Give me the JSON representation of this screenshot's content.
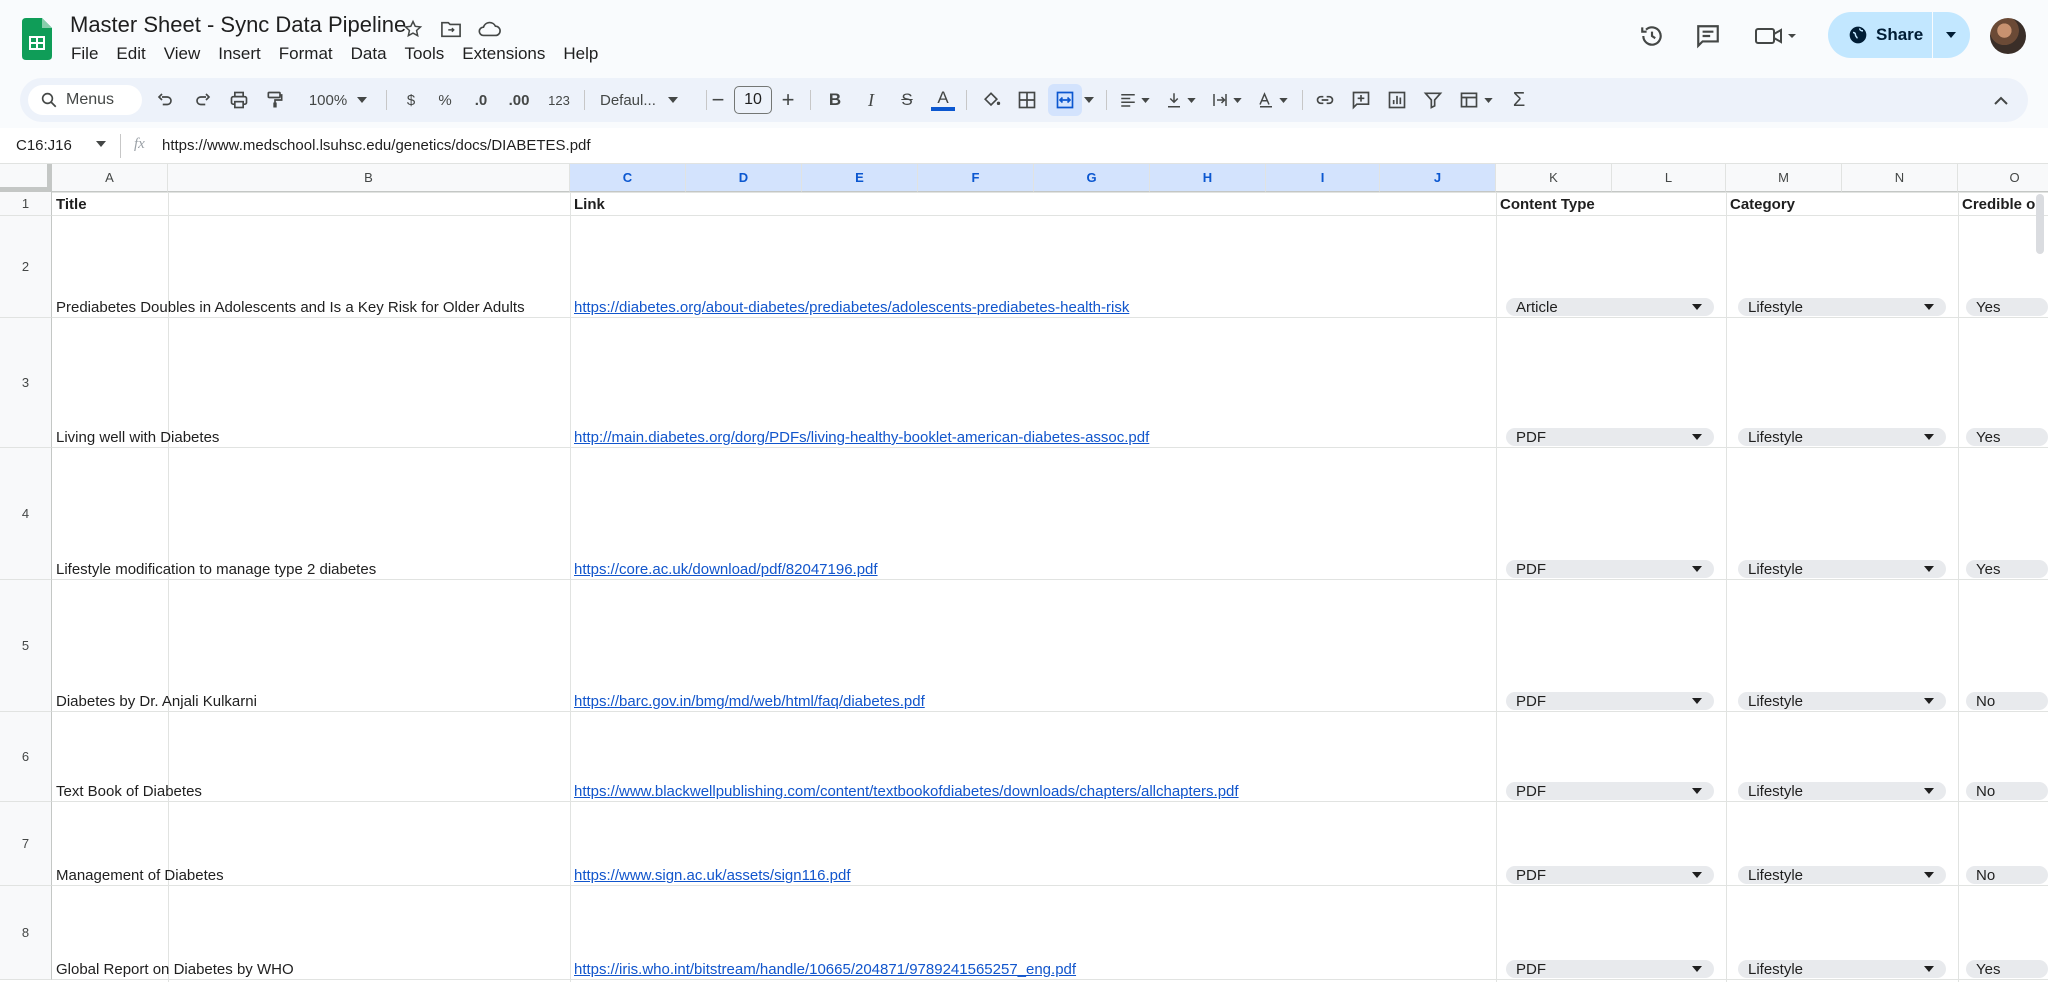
{
  "header": {
    "doc_title": "Master Sheet - Sync Data Pipeline",
    "menus": [
      "File",
      "Edit",
      "View",
      "Insert",
      "Format",
      "Data",
      "Tools",
      "Extensions",
      "Help"
    ],
    "share_label": "Share"
  },
  "toolbar": {
    "search_placeholder": "Menus",
    "zoom": "100%",
    "currency": "$",
    "percent": "%",
    "dec_decrease": ".0",
    "dec_increase": ".00",
    "number_format": "123",
    "font": "Defaul...",
    "font_size": "10"
  },
  "formula_bar": {
    "name_box": "C16:J16",
    "fx": "fx",
    "content": "https://www.medschool.lsuhsc.edu/genetics/docs/DIABETES.pdf"
  },
  "columns": [
    "A",
    "B",
    "C",
    "D",
    "E",
    "F",
    "G",
    "H",
    "I",
    "J",
    "K",
    "L",
    "M",
    "N",
    "O"
  ],
  "header_row": {
    "title": "Title",
    "link": "Link",
    "content_type": "Content Type",
    "category": "Category",
    "credible": "Credible o"
  },
  "rows": [
    {
      "num": "2",
      "title": "Prediabetes Doubles in Adolescents and Is a Key Risk for Older Adults",
      "link": "https://diabetes.org/about-diabetes/prediabetes/adolescents-prediabetes-health-risk",
      "type": "Article",
      "category": "Lifestyle",
      "credible": "Yes"
    },
    {
      "num": "3",
      "title": "Living well with Diabetes",
      "link": "http://main.diabetes.org/dorg/PDFs/living-healthy-booklet-american-diabetes-assoc.pdf",
      "type": "PDF",
      "category": "Lifestyle",
      "credible": "Yes"
    },
    {
      "num": "4",
      "title": "Lifestyle modification to manage type 2 diabetes",
      "link": "https://core.ac.uk/download/pdf/82047196.pdf",
      "type": "PDF",
      "category": "Lifestyle",
      "credible": "Yes"
    },
    {
      "num": "5",
      "title": "Diabetes by Dr. Anjali Kulkarni",
      "link": "https://barc.gov.in/bmg/md/web/html/faq/diabetes.pdf",
      "type": "PDF",
      "category": "Lifestyle",
      "credible": "No"
    },
    {
      "num": "6",
      "title": "Text Book of Diabetes",
      "link": "https://www.blackwellpublishing.com/content/textbookofdiabetes/downloads/chapters/allchapters.pdf",
      "type": "PDF",
      "category": "Lifestyle",
      "credible": "No"
    },
    {
      "num": "7",
      "title": "Management of Diabetes",
      "link": "https://www.sign.ac.uk/assets/sign116.pdf",
      "type": "PDF",
      "category": "Lifestyle",
      "credible": "No"
    },
    {
      "num": "8",
      "title": "Global Report on Diabetes by WHO",
      "link": "https://iris.who.int/bitstream/handle/10665/204871/9789241565257_eng.pdf",
      "type": "PDF",
      "category": "Lifestyle",
      "credible": "Yes"
    }
  ],
  "colors": {
    "accent": "#0b57d0",
    "share_bg": "#c2e7ff",
    "link": "#1155cc",
    "sheets_green": "#0f9d58"
  }
}
